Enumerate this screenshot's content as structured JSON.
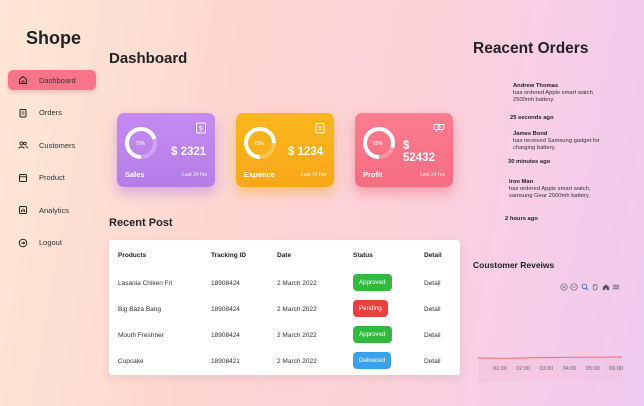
{
  "brand": "Shope",
  "nav": [
    {
      "label": "Dashboard",
      "icon": "home-icon",
      "active": true
    },
    {
      "label": "Orders",
      "icon": "clipboard-icon"
    },
    {
      "label": "Customers",
      "icon": "users-icon"
    },
    {
      "label": "Product",
      "icon": "box-icon"
    },
    {
      "label": "Analytics",
      "icon": "chart-icon"
    },
    {
      "label": "Logout",
      "icon": "logout-icon"
    }
  ],
  "main": {
    "title": "Dashboard",
    "cards": [
      {
        "label": "Sales",
        "value": "$ 2321",
        "percent": "70%",
        "sub": "Last 24 hrs",
        "icon": "dollar-icon",
        "color": "#bb82ec"
      },
      {
        "label": "Expence",
        "value": "$ 1234",
        "percent": "75%",
        "sub": "Last 24 hrs",
        "icon": "clipboard-icon",
        "color": "#f9ae1b"
      },
      {
        "label": "Profit",
        "value_line1": "$",
        "value_line2": "52432",
        "percent": "80%",
        "sub": "Last 24 hrs",
        "icon": "money-icon",
        "color": "#f97385"
      }
    ],
    "recent_post": {
      "title": "Recent Post",
      "columns": [
        "Products",
        "Tracking ID",
        "Date",
        "Status",
        "Detail"
      ],
      "rows": [
        {
          "product": "Lasania Chiken Fri",
          "tracking": "18908424",
          "date": "2 March 2022",
          "status": "Approved",
          "status_color": "#32ba3d",
          "detail": "Detail"
        },
        {
          "product": "Big Baza Bang",
          "tracking": "18908424",
          "date": "2 March 2022",
          "status": "Pending",
          "status_color": "#e9413d",
          "detail": "Detail"
        },
        {
          "product": "Mouth Freshner",
          "tracking": "18908424",
          "date": "2 March 2022",
          "status": "Approved",
          "status_color": "#32ba3d",
          "detail": "Detail"
        },
        {
          "product": "Cupcake",
          "tracking": "18908421",
          "date": "2 March 2022",
          "status": "Delivered",
          "status_color": "#3aa2ea",
          "detail": "Detail"
        }
      ]
    }
  },
  "right": {
    "title": "Reacent Orders",
    "orders": [
      {
        "name": "Andrew Thomas",
        "text": "has ordered Apple smart watch 2500mh battery.",
        "time": "25 seconds ago"
      },
      {
        "name": "James Bond",
        "text": "has received Samsung gadget for charging battery.",
        "time": "30 minutes ago"
      },
      {
        "name": "Iron Man",
        "text": "has ordered Apple smart watch, samsung Gear 2500mh battery.",
        "time": "2 hours ago"
      }
    ],
    "reviews_title": "Coustomer Reveiws",
    "toolbar": [
      "zoom-in-icon",
      "zoom-out-icon",
      "search-icon",
      "pan-icon",
      "home-icon",
      "menu-icon"
    ],
    "chart_data": {
      "type": "area",
      "x": [
        "01:00",
        "02:00",
        "03:00",
        "04:00",
        "05:00",
        "06:00"
      ],
      "series": [
        {
          "values": [
            10,
            9.5,
            10.5,
            10.8,
            11,
            11.2
          ]
        }
      ],
      "color": "#f27c84"
    }
  }
}
